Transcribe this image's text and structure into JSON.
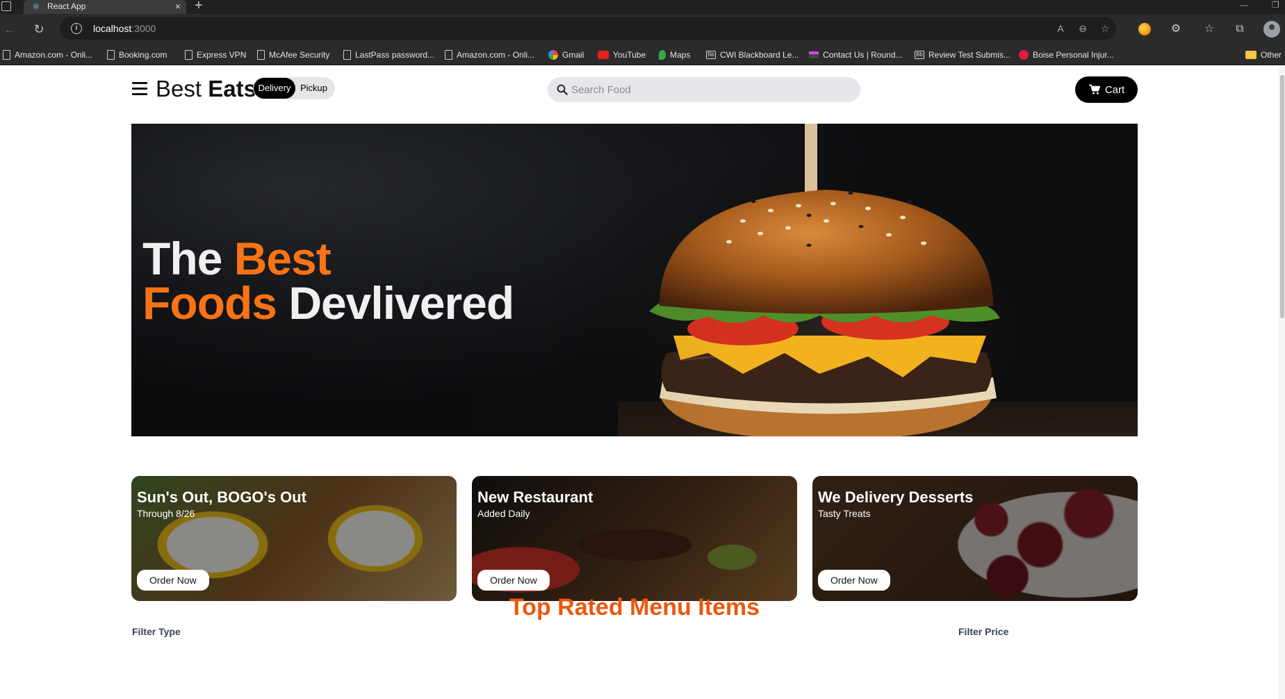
{
  "browser": {
    "tab_title": "React App",
    "url_host": "localhost",
    "url_port": ":3000",
    "bookmarks": [
      {
        "label": "Amazon.com - Onli...",
        "icon": "page-icon"
      },
      {
        "label": "Booking.com",
        "icon": "page-icon"
      },
      {
        "label": "Express VPN",
        "icon": "page-icon"
      },
      {
        "label": "McAfee Security",
        "icon": "page-icon"
      },
      {
        "label": "LastPass password...",
        "icon": "page-icon"
      },
      {
        "label": "Amazon.com - Onli...",
        "icon": "page-icon"
      },
      {
        "label": "Gmail",
        "icon": "google-icon"
      },
      {
        "label": "YouTube",
        "icon": "youtube-icon"
      },
      {
        "label": "Maps",
        "icon": "maps-icon"
      },
      {
        "label": "CWI Blackboard Le...",
        "icon": "blackboard-icon"
      },
      {
        "label": "Contact Us | Round...",
        "icon": "contact-icon"
      },
      {
        "label": "Review Test Submis...",
        "icon": "blackboard-icon"
      },
      {
        "label": "Boise Personal Injur...",
        "icon": "law-icon"
      }
    ],
    "other_bookmarks": "Other"
  },
  "nav": {
    "logo_light": "Best",
    "logo_bold": "Eats",
    "delivery": "Delivery",
    "pickup": "Pickup",
    "search_placeholder": "Search Food",
    "cart": "Cart"
  },
  "hero": {
    "line1_white": "The",
    "line1_accent": "Best",
    "line2_accent": "Foods",
    "line2_white": "Devlivered"
  },
  "cards": [
    {
      "title": "Sun's Out, BOGO's Out",
      "subtitle": "Through 8/26",
      "button": "Order Now"
    },
    {
      "title": "New Restaurant",
      "subtitle": "Added Daily",
      "button": "Order Now"
    },
    {
      "title": "We Delivery Desserts",
      "subtitle": "Tasty Treats",
      "button": "Order Now"
    }
  ],
  "menu_section": {
    "title": "Top Rated Menu Items",
    "filter_type": "Filter Type",
    "filter_price": "Filter Price"
  },
  "colors": {
    "accent": "#f97316",
    "section_title": "#ea580c",
    "primary_button": "#000000"
  }
}
